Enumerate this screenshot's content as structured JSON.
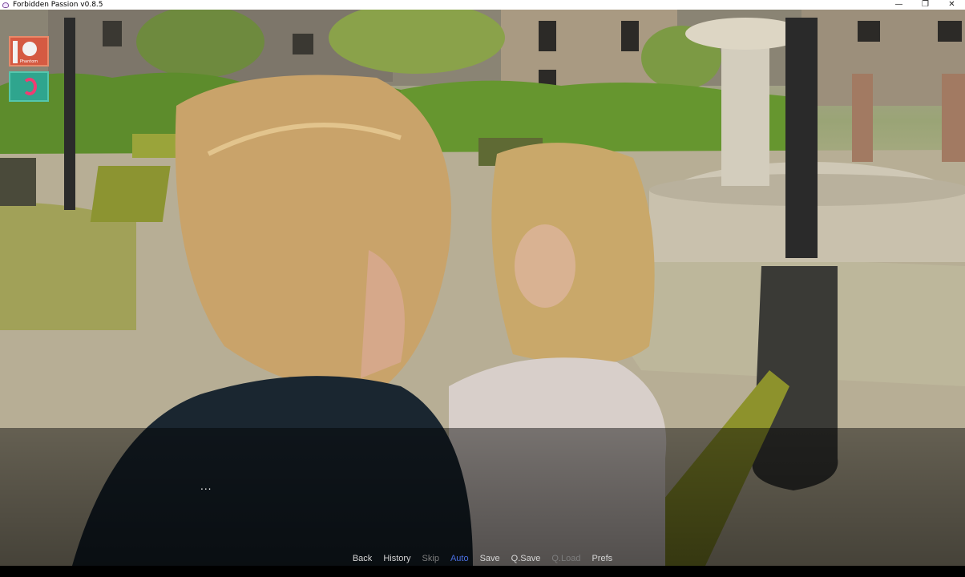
{
  "window": {
    "title": "Forbidden Passion v0.8.5",
    "controls": {
      "minimize": "—",
      "restore": "❐",
      "close": "✕"
    }
  },
  "overlay_icons": [
    {
      "name": "recorder-app-icon",
      "caption": "Phantom"
    },
    {
      "name": "secondary-app-icon",
      "caption": ""
    }
  ],
  "dialogue": {
    "text": "..."
  },
  "quick_menu": [
    {
      "label": "Back",
      "state": "normal"
    },
    {
      "label": "History",
      "state": "normal"
    },
    {
      "label": "Skip",
      "state": "disabled"
    },
    {
      "label": "Auto",
      "state": "active"
    },
    {
      "label": "Save",
      "state": "normal"
    },
    {
      "label": "Q.Save",
      "state": "normal"
    },
    {
      "label": "Q.Load",
      "state": "disabled"
    },
    {
      "label": "Prefs",
      "state": "normal"
    }
  ],
  "colors": {
    "menu_normal": "#d6d6d6",
    "menu_disabled": "#7d7d7d",
    "menu_active": "#4a6ee0"
  }
}
